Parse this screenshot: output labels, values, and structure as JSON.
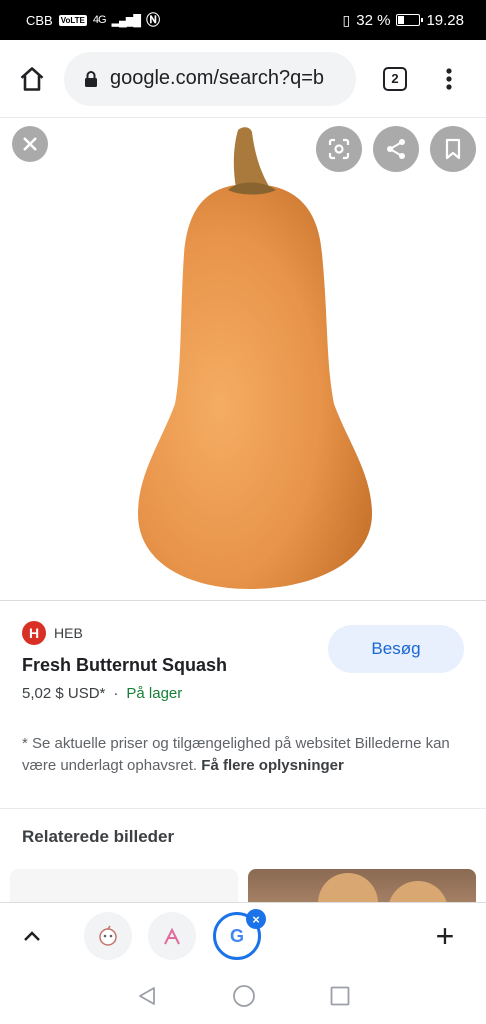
{
  "status_bar": {
    "carrier": "CBB",
    "volte": "VoLTE",
    "network": "4G",
    "battery": "32 %",
    "time": "19.28"
  },
  "browser": {
    "url": "google.com/search?q=b",
    "tab_count": "2",
    "icons": {
      "home": "home-icon",
      "lock": "lock-icon",
      "menu": "more-vert-icon"
    }
  },
  "viewer": {
    "icons": [
      "close-icon",
      "lens-icon",
      "share-icon",
      "bookmark-icon"
    ]
  },
  "result": {
    "source_logo": "H",
    "source": "HEB",
    "title": "Fresh Butternut Squash",
    "price": "5,02 $ USD*",
    "separator": "·",
    "availability": "På lager",
    "visit_button": "Besøg",
    "disclaimer": "* Se aktuelle priser og tilgængelighed på websitet Billederne kan være underlagt ophavsret.",
    "more_info": "Få flere oplysninger"
  },
  "related": {
    "title": "Relaterede billeder"
  },
  "bottom_bar": {
    "tab_badge": "×",
    "google_letter": "G",
    "new_tab": "+"
  },
  "colors": {
    "accent": "#1a73e8",
    "stock_green": "#188038",
    "squash": "#e8944a"
  }
}
